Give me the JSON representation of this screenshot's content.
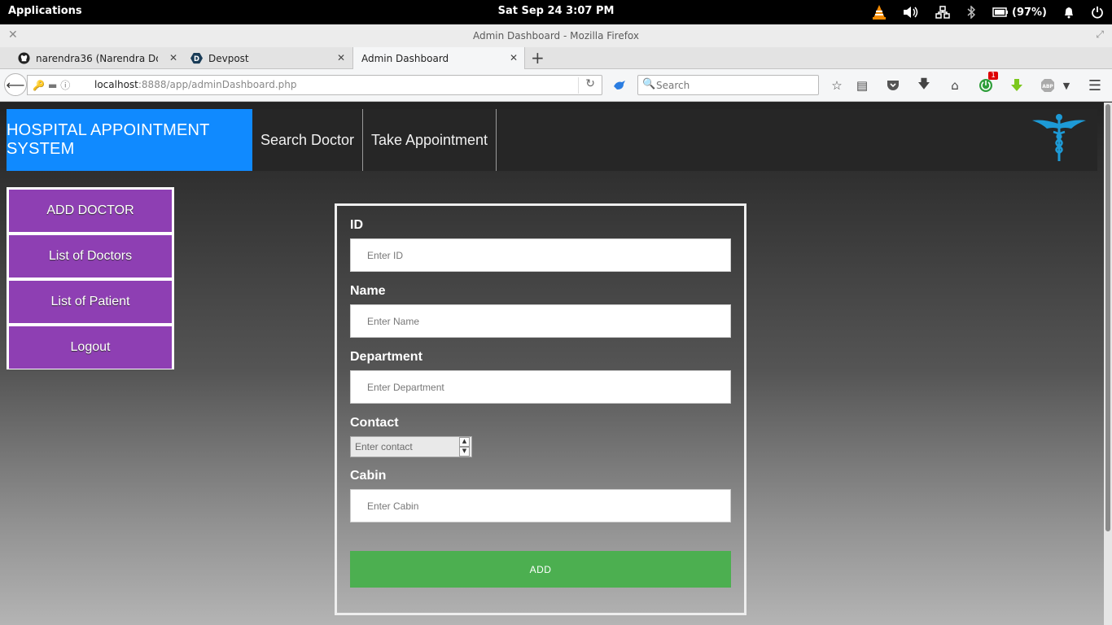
{
  "topbar": {
    "applications": "Applications",
    "clock": "Sat Sep 24   3:07 PM",
    "battery": "(97%)"
  },
  "window": {
    "title": "Admin Dashboard - Mozilla Firefox"
  },
  "tabs": [
    {
      "label": "narendra36 (Narendra Do..."
    },
    {
      "label": "Devpost"
    },
    {
      "label": "Admin Dashboard"
    }
  ],
  "navbar": {
    "url_host": "localhost",
    "url_rest": ":8888/app/adminDashboard.php",
    "search_placeholder": "Search",
    "notification_badge": "1",
    "abp_label": "ABP"
  },
  "site": {
    "brand": "HOSPITAL APPOINTMENT SYSTEM",
    "nav": [
      "Search Doctor",
      "Take Appointment"
    ],
    "brand_color": "#108aff"
  },
  "sidemenu": [
    "ADD DOCTOR",
    "List of Doctors",
    "List of Patient",
    "Logout"
  ],
  "form": {
    "id_label": "ID",
    "id_placeholder": "Enter ID",
    "name_label": "Name",
    "name_placeholder": "Enter Name",
    "department_label": "Department",
    "department_placeholder": "Enter Department",
    "contact_label": "Contact",
    "contact_placeholder": "Enter contact",
    "cabin_label": "Cabin",
    "cabin_placeholder": "Enter Cabin",
    "submit": "ADD",
    "submit_color": "#4caf50"
  },
  "colors": {
    "menu_purple": "#8e3fb3"
  }
}
